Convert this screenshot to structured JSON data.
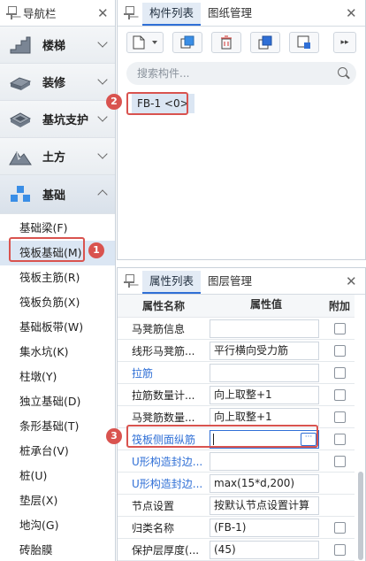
{
  "nav": {
    "title": "导航栏",
    "categories": [
      {
        "label": "楼梯",
        "icon": "stairs-icon"
      },
      {
        "label": "装修",
        "icon": "decoration-icon"
      },
      {
        "label": "基坑支护",
        "icon": "pit-support-icon"
      },
      {
        "label": "土方",
        "icon": "earthwork-icon"
      },
      {
        "label": "基础",
        "icon": "foundation-icon"
      }
    ],
    "sub_items": [
      "基础梁(F)",
      "筏板基础(M)",
      "筏板主筋(R)",
      "筏板负筋(X)",
      "基础板带(W)",
      "集水坑(K)",
      "柱墩(Y)",
      "独立基础(D)",
      "条形基础(T)",
      "桩承台(V)",
      "桩(U)",
      "垫层(X)",
      "地沟(G)",
      "砖胎膜"
    ]
  },
  "component_panel": {
    "tabs": [
      "构件列表",
      "图纸管理"
    ],
    "search_placeholder": "搜索构件...",
    "items": [
      "FB-1 <0>"
    ]
  },
  "property_panel": {
    "tabs": [
      "属性列表",
      "图层管理"
    ],
    "columns": [
      "属性名称",
      "属性值",
      "附加"
    ],
    "rows": [
      {
        "name": "马凳筋信息",
        "value": "",
        "link": false,
        "check": true
      },
      {
        "name": "线形马凳筋...",
        "value": "平行横向受力筋",
        "link": false,
        "check": true
      },
      {
        "name": "拉筋",
        "value": "",
        "link": true,
        "check": true
      },
      {
        "name": "拉筋数量计...",
        "value": "向上取整+1",
        "link": false,
        "check": true
      },
      {
        "name": "马凳筋数量...",
        "value": "向上取整+1",
        "link": false,
        "check": true
      },
      {
        "name": "筏板侧面纵筋",
        "value": "",
        "link": true,
        "check": true
      },
      {
        "name": "U形构造封边...",
        "value": "",
        "link": true,
        "check": true
      },
      {
        "name": "U形构造封边...",
        "value": "max(15*d,200)",
        "link": true,
        "check": false
      },
      {
        "name": "节点设置",
        "value": "按默认节点设置计算",
        "link": false,
        "check": false
      },
      {
        "name": "归类名称",
        "value": "(FB-1)",
        "link": false,
        "check": true
      },
      {
        "name": "保护层厚度(...",
        "value": "(45)",
        "link": false,
        "check": true
      }
    ],
    "edit_button": "···"
  },
  "annotations": [
    "1",
    "2",
    "3"
  ],
  "colors": {
    "accent": "#2f6fd6",
    "highlight": "#d9534f",
    "selected": "#dbe6f3"
  }
}
